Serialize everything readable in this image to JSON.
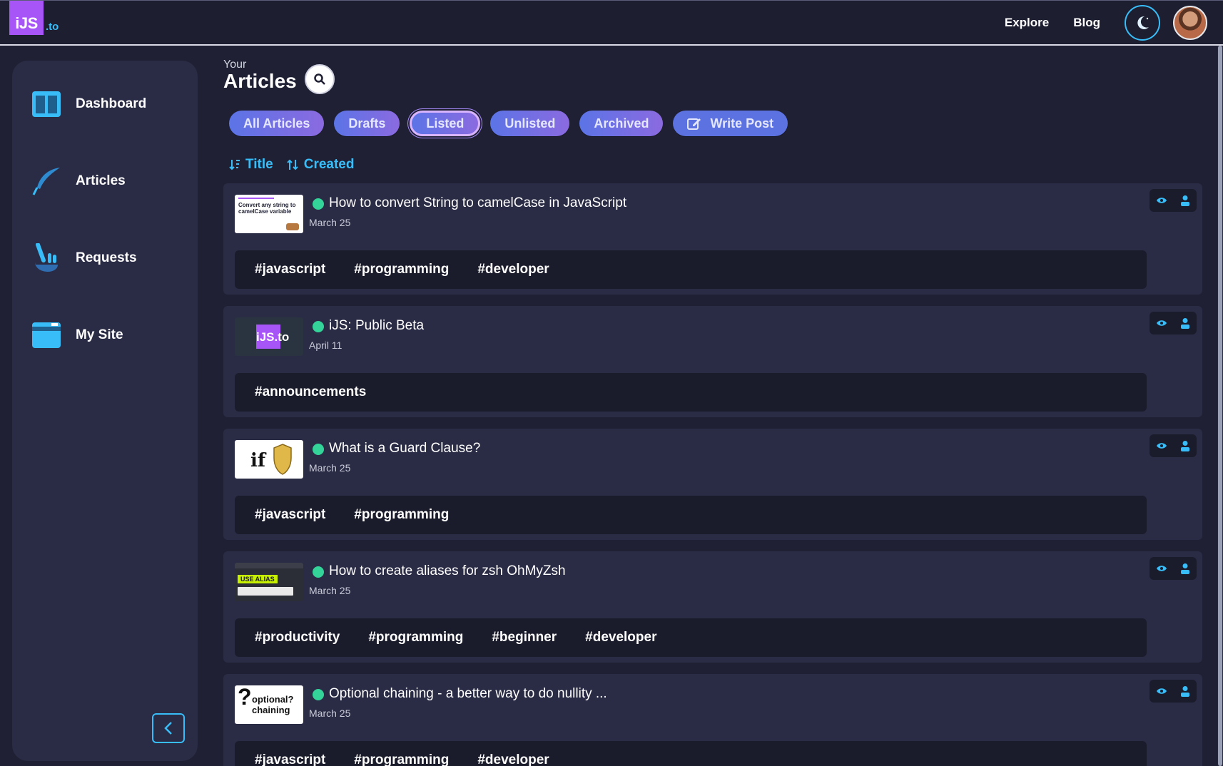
{
  "logo": {
    "main": "iJS",
    "tld": ".to"
  },
  "topnav": {
    "explore": "Explore",
    "blog": "Blog",
    "theme_icon": "moon-icon"
  },
  "sidebar": {
    "items": [
      {
        "label": "Dashboard",
        "icon": "dashboard-icon"
      },
      {
        "label": "Articles",
        "icon": "quill-icon"
      },
      {
        "label": "Requests",
        "icon": "raised-hand-icon"
      },
      {
        "label": "My Site",
        "icon": "browser-window-icon"
      }
    ],
    "collapse_icon": "chevron-left-icon"
  },
  "header": {
    "your": "Your",
    "title": "Articles"
  },
  "tabs": [
    "All Articles",
    "Drafts",
    "Listed",
    "Unlisted",
    "Archived"
  ],
  "active_tab": "Listed",
  "write_post": "Write Post",
  "sort": {
    "title": "Title",
    "created": "Created"
  },
  "articles": [
    {
      "title": "How to convert String to camelCase in JavaScript",
      "date": "March 25",
      "tags": [
        "#javascript",
        "#programming",
        "#developer"
      ],
      "thumb_text": "Convert any string to camelCase variable"
    },
    {
      "title": "iJS: Public Beta",
      "date": "April 11",
      "tags": [
        "#announcements"
      ],
      "thumb_text": "iJS.to"
    },
    {
      "title": "What is a Guard Clause?",
      "date": "March 25",
      "tags": [
        "#javascript",
        "#programming"
      ],
      "thumb_text": "if"
    },
    {
      "title": "How to create aliases for zsh OhMyZsh",
      "date": "March 25",
      "tags": [
        "#productivity",
        "#programming",
        "#beginner",
        "#developer"
      ],
      "thumb_text": "USE ALIAS"
    },
    {
      "title": "Optional chaining - a better way to do nullity ...",
      "date": "March 25",
      "tags": [
        "#javascript",
        "#programming",
        "#developer"
      ],
      "thumb_text": "optional? chaining"
    }
  ],
  "colors": {
    "accent": "#38bdf8",
    "brand": "#a855f7",
    "published": "#34d399",
    "panel": "#2a2b45",
    "background": "#1f2033"
  }
}
